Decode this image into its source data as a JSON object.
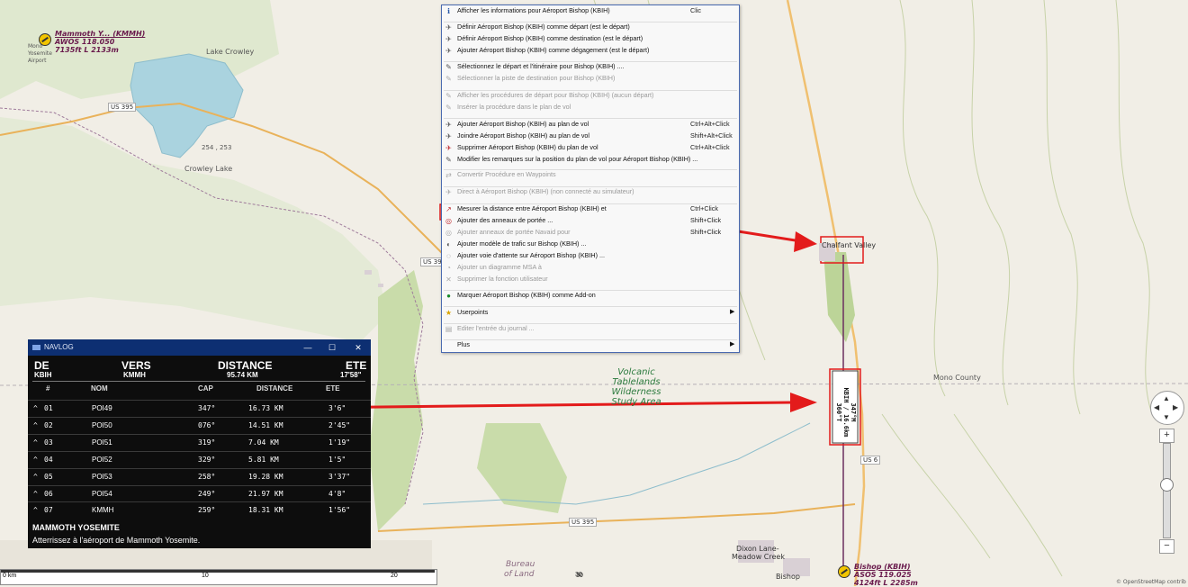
{
  "map": {
    "places": {
      "lake_crowley": "Lake Crowley",
      "crowley_lake": "Crowley Lake",
      "chalfant_valley": "Chalfant Valley",
      "mono_county": "Mono County",
      "dixon_lane": "Dixon Lane-",
      "meadow_creek": "Meadow Creek",
      "bureau": "Bureau",
      "of_land": "of Land",
      "bishop": "Bishop",
      "wilderness": [
        "Volcanic",
        "Tablelands",
        "Wilderness",
        "Study Area"
      ],
      "mono": "Mono",
      "yosemite": "Yosemite",
      "airport_word": "Airport"
    },
    "highways": [
      "US 395",
      "US 395",
      "US 395",
      "US 6"
    ],
    "elevation_label": "254 , 253",
    "airport_mammoth": {
      "name": "Mammoth Y... (KMMH)",
      "line2": "AWOS 118.050",
      "line3": "7135ft L 2133m"
    },
    "airport_bishop": {
      "name": "Bishop (KBIH)",
      "line2": "ASOS 119.025",
      "line3": "4124ft L 2285m"
    },
    "leg_label": [
      "347°M",
      "KBIH / 16.6km",
      "360°T"
    ],
    "copyright": "© OpenStreetMap contrib",
    "scale": {
      "labels": [
        "0 km",
        "10",
        "20",
        "30"
      ]
    },
    "accent": "#e31b1b",
    "route_color": "#6b2e5f"
  },
  "context_menu": {
    "items": [
      {
        "label": "Afficher les informations pour Aéroport Bishop (KBIH)",
        "shortcut": "Clic",
        "icon": "info-icon",
        "disabled": false
      },
      {
        "label": "Définir Aéroport Bishop (KBIH) comme départ (est le départ)",
        "shortcut": "",
        "icon": "departure-icon",
        "disabled": false
      },
      {
        "label": "Définir Aéroport Bishop (KBIH) comme destination (est le départ)",
        "shortcut": "",
        "icon": "destination-icon",
        "disabled": false
      },
      {
        "label": "Ajouter Aéroport Bishop (KBIH) comme dégagement (est le départ)",
        "shortcut": "",
        "icon": "alternate-icon",
        "disabled": false
      },
      {
        "label": "Sélectionnez le départ et l'itinéraire pour Bishop (KBIH) ....",
        "shortcut": "",
        "icon": "route-icon",
        "disabled": false
      },
      {
        "label": "Sélectionner la piste de destination pour Bishop (KBIH)",
        "shortcut": "",
        "icon": "runway-icon",
        "disabled": true
      },
      {
        "label": "Afficher les procédures de départ pour Bishop (KBIH) (aucun départ)",
        "shortcut": "",
        "icon": "procedure-icon",
        "disabled": true
      },
      {
        "label": "Insérer la procédure  dans le plan de vol",
        "shortcut": "",
        "icon": "insert-icon",
        "disabled": true
      },
      {
        "label": "Ajouter Aéroport Bishop (KBIH) au plan de vol",
        "shortcut": "Ctrl+Alt+Click",
        "icon": "add-icon",
        "disabled": false
      },
      {
        "label": "Joindre Aéroport Bishop (KBIH) au plan de vol",
        "shortcut": "Shift+Alt+Click",
        "icon": "append-icon",
        "disabled": false
      },
      {
        "label": "Supprimer Aéroport Bishop (KBIH) du plan de vol",
        "shortcut": "Ctrl+Alt+Click",
        "icon": "delete-icon",
        "disabled": false
      },
      {
        "label": "Modifier les remarques sur la position du plan de vol pour Aéroport Bishop (KBIH) ...",
        "shortcut": "",
        "icon": "edit-icon",
        "disabled": false
      },
      {
        "label": "Convertir Procédure en Waypoints",
        "shortcut": "",
        "icon": "convert-icon",
        "disabled": true
      },
      {
        "label": "Direct à Aéroport Bishop (KBIH) (non connecté au simulateur)",
        "shortcut": "",
        "icon": "direct-icon",
        "disabled": true
      },
      {
        "label": "Mesurer la distance entre Aéroport Bishop (KBIH) et",
        "shortcut": "Ctrl+Click",
        "icon": "measure-icon",
        "disabled": false
      },
      {
        "label": "Ajouter des anneaux de portée ...",
        "shortcut": "Shift+Click",
        "icon": "range-rings-icon",
        "disabled": false
      },
      {
        "label": "Ajouter anneaux de portée Navaid pour",
        "shortcut": "Shift+Click",
        "icon": "navaid-rings-icon",
        "disabled": true
      },
      {
        "label": "Ajouter modèle de trafic sur Bishop (KBIH) ...",
        "shortcut": "",
        "icon": "traffic-icon",
        "disabled": false
      },
      {
        "label": "Ajouter voie d'attente sur Aéroport Bishop (KBIH) ...",
        "shortcut": "",
        "icon": "hold-icon",
        "disabled": false
      },
      {
        "label": "Ajouter un diagramme MSA à",
        "shortcut": "",
        "icon": "msa-icon",
        "disabled": true
      },
      {
        "label": "Supprimer la fonction utilisateur",
        "shortcut": "",
        "icon": "remove-icon",
        "disabled": true
      },
      {
        "label": "Marquer Aéroport Bishop (KBIH) comme Add-on",
        "shortcut": "",
        "icon": "addon-icon",
        "disabled": false
      },
      {
        "label": "Userpoints",
        "shortcut": "",
        "icon": "star-icon",
        "disabled": false,
        "submenu": true
      },
      {
        "label": "Editer l'entrée du journal ...",
        "shortcut": "",
        "icon": "logbook-icon",
        "disabled": true
      },
      {
        "label": "Plus",
        "shortcut": "",
        "icon": "",
        "disabled": false,
        "submenu": true
      }
    ]
  },
  "navlog": {
    "title": "NAVLOG",
    "header": {
      "de_label": "DE",
      "de_value": "KBIH",
      "vers_label": "VERS",
      "vers_value": "KMMH",
      "distance_label": "DISTANCE",
      "distance_value": "95.74 KM",
      "ete_label": "ETE",
      "ete_value": "17'58\""
    },
    "columns": [
      "#",
      "NOM",
      "CAP",
      "DISTANCE",
      "ETE"
    ],
    "rows": [
      {
        "num": "01",
        "name": "POI49",
        "cap": "347°",
        "dist": "16.73 KM",
        "ete": "3'6\""
      },
      {
        "num": "02",
        "name": "POI50",
        "cap": "076°",
        "dist": "14.51 KM",
        "ete": "2'45\""
      },
      {
        "num": "03",
        "name": "POI51",
        "cap": "319°",
        "dist": "7.04 KM",
        "ete": "1'19\""
      },
      {
        "num": "04",
        "name": "POI52",
        "cap": "329°",
        "dist": "5.81 KM",
        "ete": "1'5\""
      },
      {
        "num": "05",
        "name": "POI53",
        "cap": "258°",
        "dist": "19.28 KM",
        "ete": "3'37\""
      },
      {
        "num": "06",
        "name": "POI54",
        "cap": "249°",
        "dist": "21.97 KM",
        "ete": "4'8\""
      },
      {
        "num": "07",
        "name": "KMMH",
        "cap": "259°",
        "dist": "18.31 KM",
        "ete": "1'56\""
      }
    ],
    "footer_title": "MAMMOTH YOSEMITE",
    "footer_text": "Atterrissez à l'aéroport de Mammoth Yosemite."
  }
}
